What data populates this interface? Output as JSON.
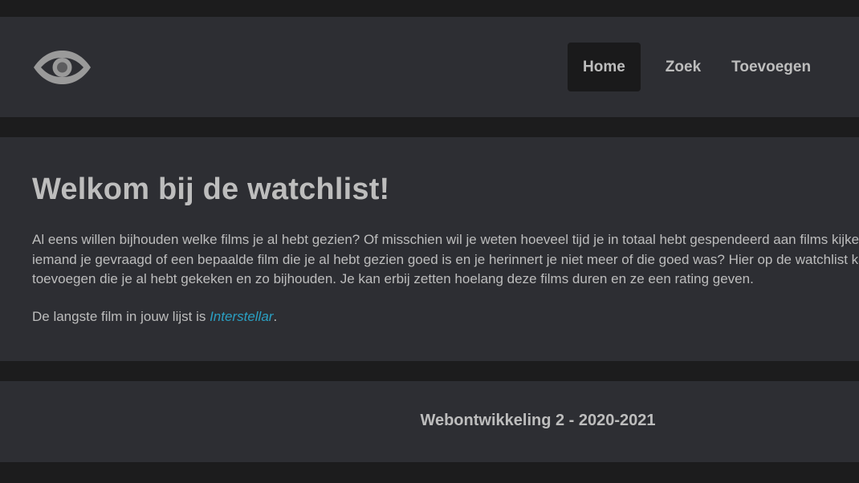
{
  "header": {
    "logo_icon": "eye-icon",
    "nav": [
      {
        "label": "Home",
        "active": true
      },
      {
        "label": "Zoek",
        "active": false
      },
      {
        "label": "Toevoegen",
        "active": false
      }
    ]
  },
  "main": {
    "title": "Welkom bij de watchlist!",
    "intro_lines": [
      "Al eens willen bijhouden welke films je al hebt gezien? Of misschien wil je weten hoeveel tijd je in totaal hebt gespendeerd aan films kijken? Of heeft",
      "iemand je gevraagd of een bepaalde film die je al hebt gezien goed is en je herinnert je niet meer of die goed was? Hier op de watchlist kan je films",
      "toevoegen die je al hebt gekeken en zo bijhouden. Je kan erbij zetten hoelang deze films duren en ze een rating geven."
    ],
    "longest_prefix": "De langste film in jouw lijst is ",
    "longest_film": "Interstellar",
    "longest_suffix": "."
  },
  "footer": {
    "text": "Webontwikkeling 2 - 2020-2021"
  },
  "colors": {
    "background": "#1c1c1d",
    "panel": "#2d2e33",
    "text": "#bdbdbd",
    "link": "#2a9fc2",
    "active_nav": "#1a1a1b"
  }
}
